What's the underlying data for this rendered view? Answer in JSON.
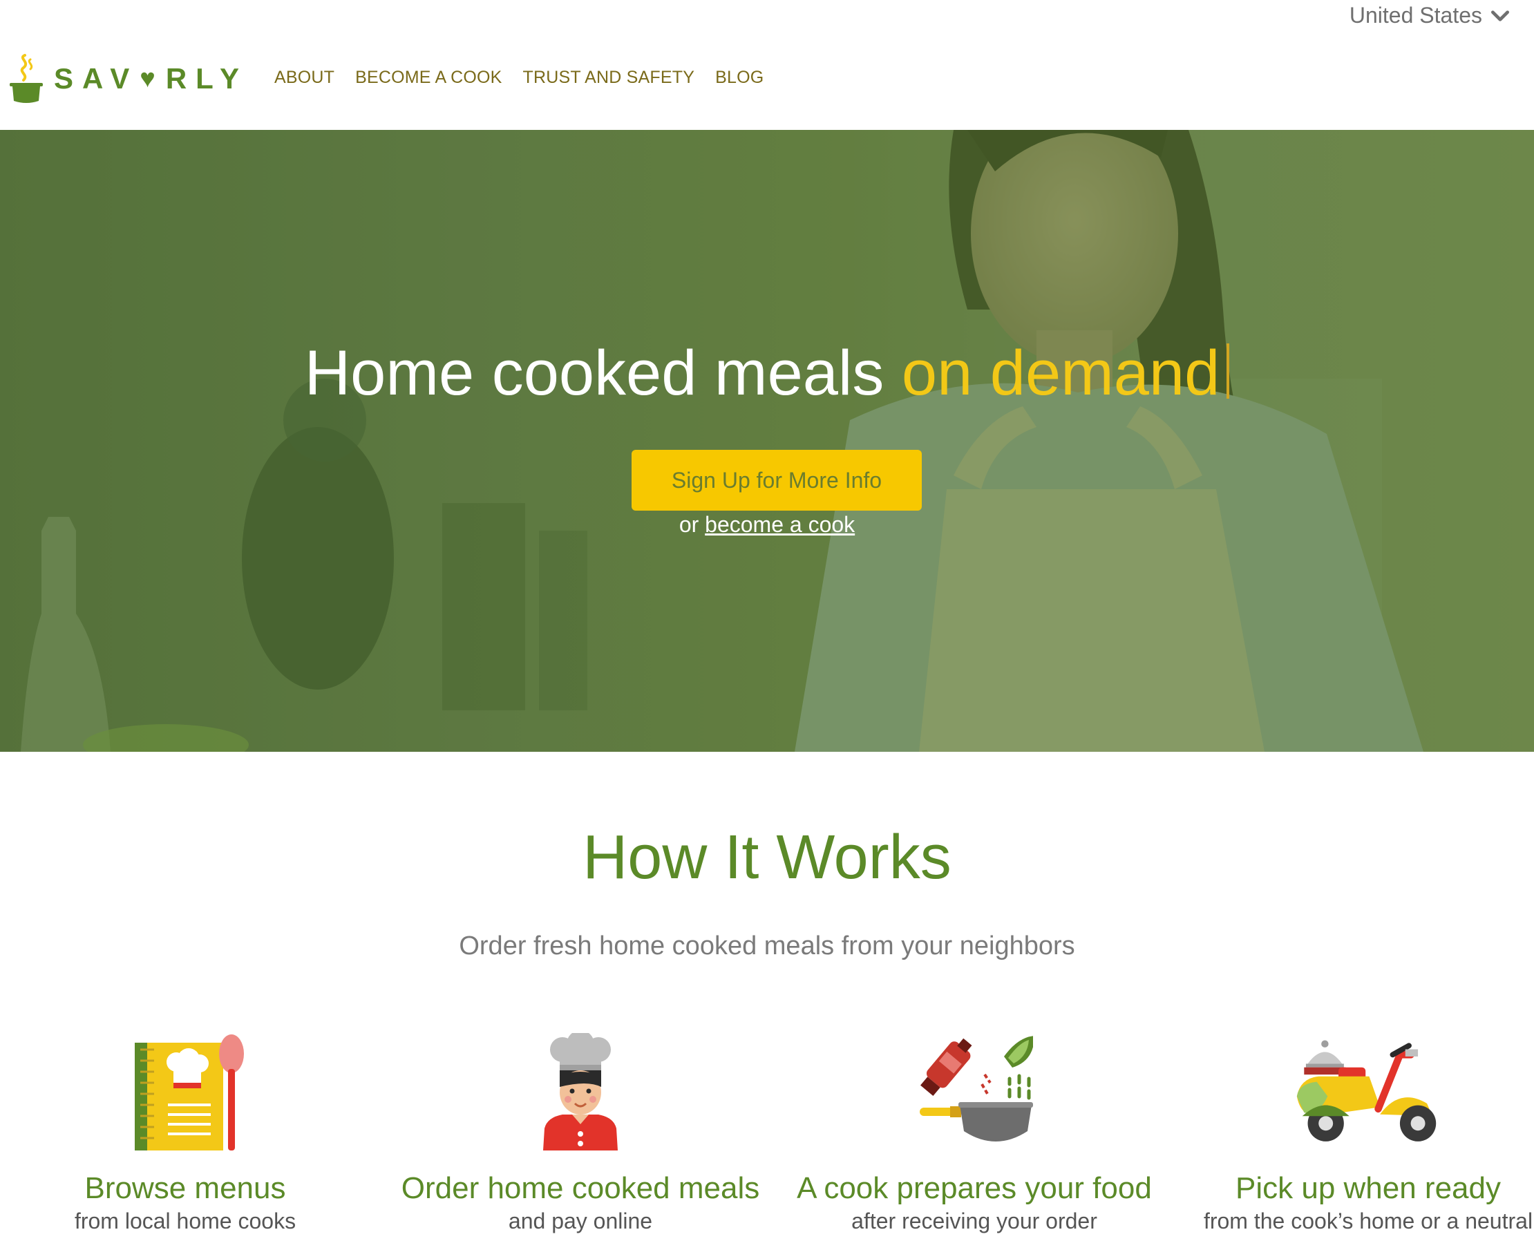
{
  "header": {
    "country_selector": "United States",
    "logo": {
      "text_before": "SAV",
      "text_after": "RLY"
    },
    "nav": [
      "About",
      "Become a Cook",
      "Trust and Safety",
      "Blog"
    ]
  },
  "hero": {
    "title_main": "Home cooked meals ",
    "title_accent": "on demand",
    "cta_button": "Sign Up for More Info",
    "cta_sub_prefix": "or ",
    "cta_sub_link": "become a cook"
  },
  "how_it_works": {
    "title": "How It Works",
    "subtitle": "Order fresh home cooked meals from your neighbors",
    "steps": [
      {
        "icon": "menu-book-icon",
        "title": "Browse menus",
        "desc": "from local home cooks"
      },
      {
        "icon": "chef-icon",
        "title": "Order home cooked meals",
        "desc": "and pay online"
      },
      {
        "icon": "cooking-pan-icon",
        "title": "A cook prepares your food",
        "desc": "after receiving your order"
      },
      {
        "icon": "delivery-scooter-icon",
        "title": "Pick up when ready",
        "desc": "from the cook’s home or a neutral"
      }
    ]
  },
  "colors": {
    "brand_green": "#5b8a28",
    "accent_yellow": "#f3c817",
    "button_yellow": "#f7c800",
    "nav_text": "#7a6a1a"
  }
}
